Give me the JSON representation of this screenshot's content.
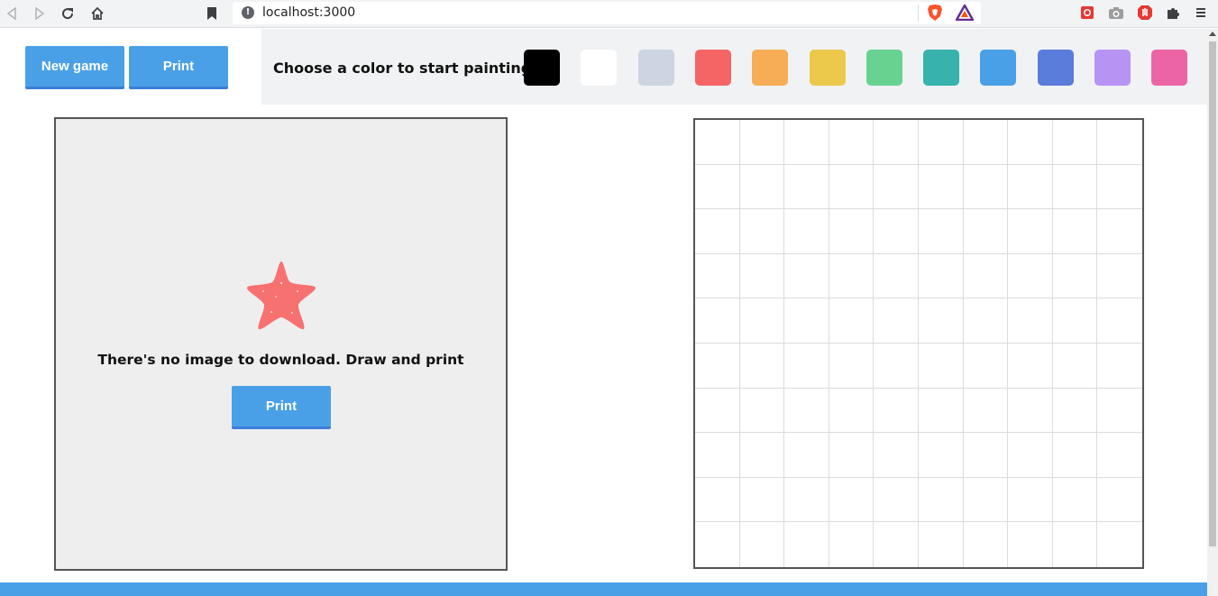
{
  "browser": {
    "url": "localhost:3000"
  },
  "toolbar": {
    "new_game_label": "New game",
    "print_label": "Print"
  },
  "palette": {
    "label": "Choose a color to start painting:",
    "colors": [
      {
        "name": "black",
        "hex": "#000000"
      },
      {
        "name": "white",
        "hex": "#ffffff"
      },
      {
        "name": "light-gray",
        "hex": "#cdd5e3"
      },
      {
        "name": "red",
        "hex": "#f56565"
      },
      {
        "name": "orange",
        "hex": "#f6ad55"
      },
      {
        "name": "yellow",
        "hex": "#ecc94b"
      },
      {
        "name": "green",
        "hex": "#68d391"
      },
      {
        "name": "teal",
        "hex": "#38b2ac"
      },
      {
        "name": "blue",
        "hex": "#4aa0e6"
      },
      {
        "name": "indigo",
        "hex": "#5a7ddb"
      },
      {
        "name": "purple",
        "hex": "#b794f4"
      },
      {
        "name": "pink",
        "hex": "#ed64a6"
      }
    ]
  },
  "preview": {
    "message": "There's no image to download. Draw and print",
    "print_label": "Print",
    "icon": "starfish-icon"
  },
  "canvas": {
    "rows": 10,
    "cols": 10
  },
  "theme": {
    "accent": "#4aa0e6",
    "accent_dark": "#3b7dd8"
  }
}
